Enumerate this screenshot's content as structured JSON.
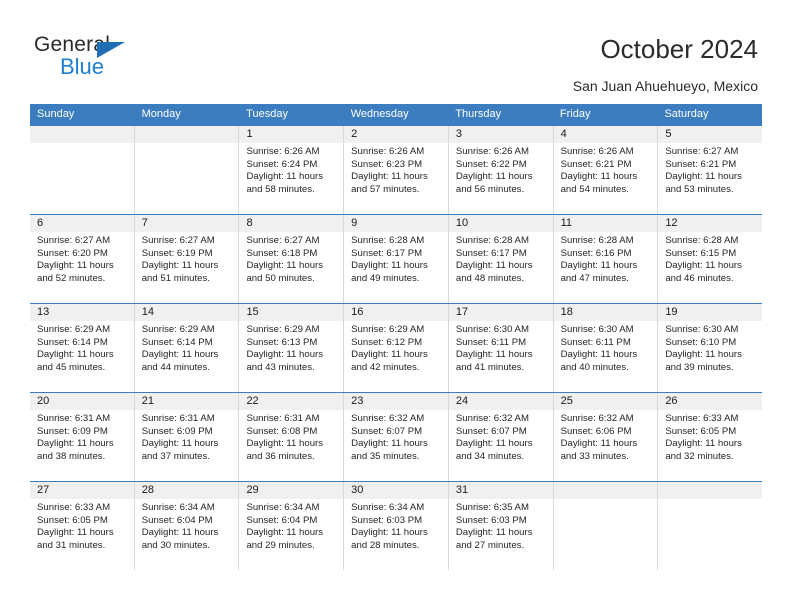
{
  "brand": {
    "name_top": "General",
    "name_bottom": "Blue",
    "triangle_icon": "triangle-icon",
    "accent_color": "#1f7fd0"
  },
  "header": {
    "title": "October 2024",
    "subtitle": "San Juan Ahuehueyo, Mexico"
  },
  "calendar": {
    "header_bg": "#3b7dbf",
    "daynum_bg": "#f0f0f0",
    "day_names": [
      "Sunday",
      "Monday",
      "Tuesday",
      "Wednesday",
      "Thursday",
      "Friday",
      "Saturday"
    ],
    "labels": {
      "sunrise": "Sunrise:",
      "sunset": "Sunset:",
      "daylight": "Daylight:"
    },
    "weeks": [
      [
        {
          "day": "",
          "empty": true
        },
        {
          "day": "",
          "empty": true
        },
        {
          "day": "1",
          "sunrise": "Sunrise: 6:26 AM",
          "sunset": "Sunset: 6:24 PM",
          "daylight_1": "Daylight: 11 hours",
          "daylight_2": "and 58 minutes."
        },
        {
          "day": "2",
          "sunrise": "Sunrise: 6:26 AM",
          "sunset": "Sunset: 6:23 PM",
          "daylight_1": "Daylight: 11 hours",
          "daylight_2": "and 57 minutes."
        },
        {
          "day": "3",
          "sunrise": "Sunrise: 6:26 AM",
          "sunset": "Sunset: 6:22 PM",
          "daylight_1": "Daylight: 11 hours",
          "daylight_2": "and 56 minutes."
        },
        {
          "day": "4",
          "sunrise": "Sunrise: 6:26 AM",
          "sunset": "Sunset: 6:21 PM",
          "daylight_1": "Daylight: 11 hours",
          "daylight_2": "and 54 minutes."
        },
        {
          "day": "5",
          "sunrise": "Sunrise: 6:27 AM",
          "sunset": "Sunset: 6:21 PM",
          "daylight_1": "Daylight: 11 hours",
          "daylight_2": "and 53 minutes."
        }
      ],
      [
        {
          "day": "6",
          "sunrise": "Sunrise: 6:27 AM",
          "sunset": "Sunset: 6:20 PM",
          "daylight_1": "Daylight: 11 hours",
          "daylight_2": "and 52 minutes."
        },
        {
          "day": "7",
          "sunrise": "Sunrise: 6:27 AM",
          "sunset": "Sunset: 6:19 PM",
          "daylight_1": "Daylight: 11 hours",
          "daylight_2": "and 51 minutes."
        },
        {
          "day": "8",
          "sunrise": "Sunrise: 6:27 AM",
          "sunset": "Sunset: 6:18 PM",
          "daylight_1": "Daylight: 11 hours",
          "daylight_2": "and 50 minutes."
        },
        {
          "day": "9",
          "sunrise": "Sunrise: 6:28 AM",
          "sunset": "Sunset: 6:17 PM",
          "daylight_1": "Daylight: 11 hours",
          "daylight_2": "and 49 minutes."
        },
        {
          "day": "10",
          "sunrise": "Sunrise: 6:28 AM",
          "sunset": "Sunset: 6:17 PM",
          "daylight_1": "Daylight: 11 hours",
          "daylight_2": "and 48 minutes."
        },
        {
          "day": "11",
          "sunrise": "Sunrise: 6:28 AM",
          "sunset": "Sunset: 6:16 PM",
          "daylight_1": "Daylight: 11 hours",
          "daylight_2": "and 47 minutes."
        },
        {
          "day": "12",
          "sunrise": "Sunrise: 6:28 AM",
          "sunset": "Sunset: 6:15 PM",
          "daylight_1": "Daylight: 11 hours",
          "daylight_2": "and 46 minutes."
        }
      ],
      [
        {
          "day": "13",
          "sunrise": "Sunrise: 6:29 AM",
          "sunset": "Sunset: 6:14 PM",
          "daylight_1": "Daylight: 11 hours",
          "daylight_2": "and 45 minutes."
        },
        {
          "day": "14",
          "sunrise": "Sunrise: 6:29 AM",
          "sunset": "Sunset: 6:14 PM",
          "daylight_1": "Daylight: 11 hours",
          "daylight_2": "and 44 minutes."
        },
        {
          "day": "15",
          "sunrise": "Sunrise: 6:29 AM",
          "sunset": "Sunset: 6:13 PM",
          "daylight_1": "Daylight: 11 hours",
          "daylight_2": "and 43 minutes."
        },
        {
          "day": "16",
          "sunrise": "Sunrise: 6:29 AM",
          "sunset": "Sunset: 6:12 PM",
          "daylight_1": "Daylight: 11 hours",
          "daylight_2": "and 42 minutes."
        },
        {
          "day": "17",
          "sunrise": "Sunrise: 6:30 AM",
          "sunset": "Sunset: 6:11 PM",
          "daylight_1": "Daylight: 11 hours",
          "daylight_2": "and 41 minutes."
        },
        {
          "day": "18",
          "sunrise": "Sunrise: 6:30 AM",
          "sunset": "Sunset: 6:11 PM",
          "daylight_1": "Daylight: 11 hours",
          "daylight_2": "and 40 minutes."
        },
        {
          "day": "19",
          "sunrise": "Sunrise: 6:30 AM",
          "sunset": "Sunset: 6:10 PM",
          "daylight_1": "Daylight: 11 hours",
          "daylight_2": "and 39 minutes."
        }
      ],
      [
        {
          "day": "20",
          "sunrise": "Sunrise: 6:31 AM",
          "sunset": "Sunset: 6:09 PM",
          "daylight_1": "Daylight: 11 hours",
          "daylight_2": "and 38 minutes."
        },
        {
          "day": "21",
          "sunrise": "Sunrise: 6:31 AM",
          "sunset": "Sunset: 6:09 PM",
          "daylight_1": "Daylight: 11 hours",
          "daylight_2": "and 37 minutes."
        },
        {
          "day": "22",
          "sunrise": "Sunrise: 6:31 AM",
          "sunset": "Sunset: 6:08 PM",
          "daylight_1": "Daylight: 11 hours",
          "daylight_2": "and 36 minutes."
        },
        {
          "day": "23",
          "sunrise": "Sunrise: 6:32 AM",
          "sunset": "Sunset: 6:07 PM",
          "daylight_1": "Daylight: 11 hours",
          "daylight_2": "and 35 minutes."
        },
        {
          "day": "24",
          "sunrise": "Sunrise: 6:32 AM",
          "sunset": "Sunset: 6:07 PM",
          "daylight_1": "Daylight: 11 hours",
          "daylight_2": "and 34 minutes."
        },
        {
          "day": "25",
          "sunrise": "Sunrise: 6:32 AM",
          "sunset": "Sunset: 6:06 PM",
          "daylight_1": "Daylight: 11 hours",
          "daylight_2": "and 33 minutes."
        },
        {
          "day": "26",
          "sunrise": "Sunrise: 6:33 AM",
          "sunset": "Sunset: 6:05 PM",
          "daylight_1": "Daylight: 11 hours",
          "daylight_2": "and 32 minutes."
        }
      ],
      [
        {
          "day": "27",
          "sunrise": "Sunrise: 6:33 AM",
          "sunset": "Sunset: 6:05 PM",
          "daylight_1": "Daylight: 11 hours",
          "daylight_2": "and 31 minutes."
        },
        {
          "day": "28",
          "sunrise": "Sunrise: 6:34 AM",
          "sunset": "Sunset: 6:04 PM",
          "daylight_1": "Daylight: 11 hours",
          "daylight_2": "and 30 minutes."
        },
        {
          "day": "29",
          "sunrise": "Sunrise: 6:34 AM",
          "sunset": "Sunset: 6:04 PM",
          "daylight_1": "Daylight: 11 hours",
          "daylight_2": "and 29 minutes."
        },
        {
          "day": "30",
          "sunrise": "Sunrise: 6:34 AM",
          "sunset": "Sunset: 6:03 PM",
          "daylight_1": "Daylight: 11 hours",
          "daylight_2": "and 28 minutes."
        },
        {
          "day": "31",
          "sunrise": "Sunrise: 6:35 AM",
          "sunset": "Sunset: 6:03 PM",
          "daylight_1": "Daylight: 11 hours",
          "daylight_2": "and 27 minutes."
        },
        {
          "day": "",
          "empty": true
        },
        {
          "day": "",
          "empty": true
        }
      ]
    ]
  }
}
